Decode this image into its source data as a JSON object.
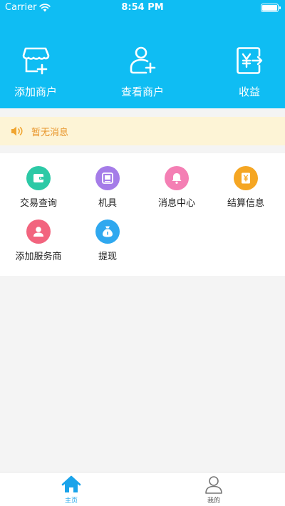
{
  "status_bar": {
    "carrier": "Carrier",
    "time": "8:54 PM",
    "battery_level": 1.0
  },
  "header": {
    "background": "#0fbdf3",
    "actions": [
      {
        "label": "添加商户",
        "icon": "add-store-icon"
      },
      {
        "label": "查看商户",
        "icon": "add-user-icon"
      },
      {
        "label": "收益",
        "icon": "yuan-exchange-icon"
      }
    ]
  },
  "notice": {
    "text": "暂无消息",
    "icon": "speaker-icon",
    "color": "#e8952a"
  },
  "menu": {
    "items": [
      {
        "label": "交易查询",
        "icon": "wallet-icon",
        "color": "#2cc9a6"
      },
      {
        "label": "机具",
        "icon": "device-icon",
        "color": "#a57ce8"
      },
      {
        "label": "消息中心",
        "icon": "bell-icon",
        "color": "#f47fb4"
      },
      {
        "label": "结算信息",
        "icon": "yuan-card-icon",
        "color": "#f5a623"
      },
      {
        "label": "添加服务商",
        "icon": "person-icon",
        "color": "#f2647e"
      },
      {
        "label": "提现",
        "icon": "money-bag-icon",
        "color": "#2fa8ef"
      }
    ]
  },
  "tabbar": {
    "active_color": "#1aa3ea",
    "inactive_color": "#777777",
    "tabs": [
      {
        "label": "主页",
        "icon": "home-icon",
        "active": true
      },
      {
        "label": "我的",
        "icon": "profile-icon",
        "active": false
      }
    ]
  }
}
